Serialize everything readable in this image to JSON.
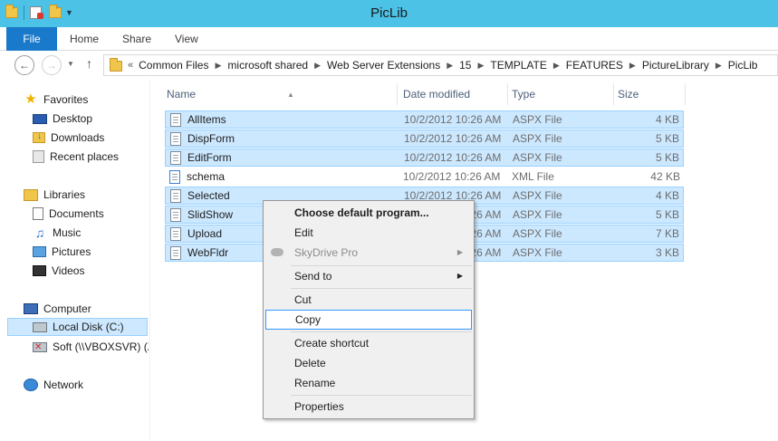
{
  "window": {
    "title": "PicLib"
  },
  "ribbon": {
    "tabs": [
      "File",
      "Home",
      "Share",
      "View"
    ]
  },
  "address": {
    "overflow": "«",
    "crumbs": [
      "Common Files",
      "microsoft shared",
      "Web Server Extensions",
      "15",
      "TEMPLATE",
      "FEATURES",
      "PictureLibrary",
      "PicLib"
    ]
  },
  "navpane": {
    "favorites": "Favorites",
    "desktop": "Desktop",
    "downloads": "Downloads",
    "recent": "Recent places",
    "libraries": "Libraries",
    "documents": "Documents",
    "music": "Music",
    "pictures": "Pictures",
    "videos": "Videos",
    "computer": "Computer",
    "localdisk": "Local Disk (C:)",
    "soft": "Soft (\\\\VBOXSVR) (Z",
    "network": "Network"
  },
  "columns": {
    "name": "Name",
    "date": "Date modified",
    "type": "Type",
    "size": "Size"
  },
  "files": [
    {
      "name": "AllItems",
      "date": "10/2/2012 10:26 AM",
      "type": "ASPX File",
      "size": "4 KB"
    },
    {
      "name": "DispForm",
      "date": "10/2/2012 10:26 AM",
      "type": "ASPX File",
      "size": "5 KB"
    },
    {
      "name": "EditForm",
      "date": "10/2/2012 10:26 AM",
      "type": "ASPX File",
      "size": "5 KB"
    },
    {
      "name": "schema",
      "date": "10/2/2012 10:26 AM",
      "type": "XML File",
      "size": "42 KB"
    },
    {
      "name": "Selected",
      "date": "10/2/2012 10:26 AM",
      "type": "ASPX File",
      "size": "4 KB"
    },
    {
      "name": "SlidShow",
      "date": "10/2/2012 10:26 AM",
      "type": "ASPX File",
      "size": "5 KB"
    },
    {
      "name": "Upload",
      "date": "10/2/2012 10:26 AM",
      "type": "ASPX File",
      "size": "7 KB"
    },
    {
      "name": "WebFldr",
      "date": "10/2/2012 10:26 AM",
      "type": "ASPX File",
      "size": "3 KB"
    }
  ],
  "context_menu": {
    "choose_default": "Choose default program...",
    "edit": "Edit",
    "skydrive": "SkyDrive Pro",
    "send_to": "Send to",
    "cut": "Cut",
    "copy": "Copy",
    "create_shortcut": "Create shortcut",
    "delete": "Delete",
    "rename": "Rename",
    "properties": "Properties"
  },
  "colors": {
    "titlebar": "#4cc2e6",
    "file_tab": "#1979ca",
    "selection": "#cce8ff",
    "menu_hover_border": "#3399ff"
  }
}
